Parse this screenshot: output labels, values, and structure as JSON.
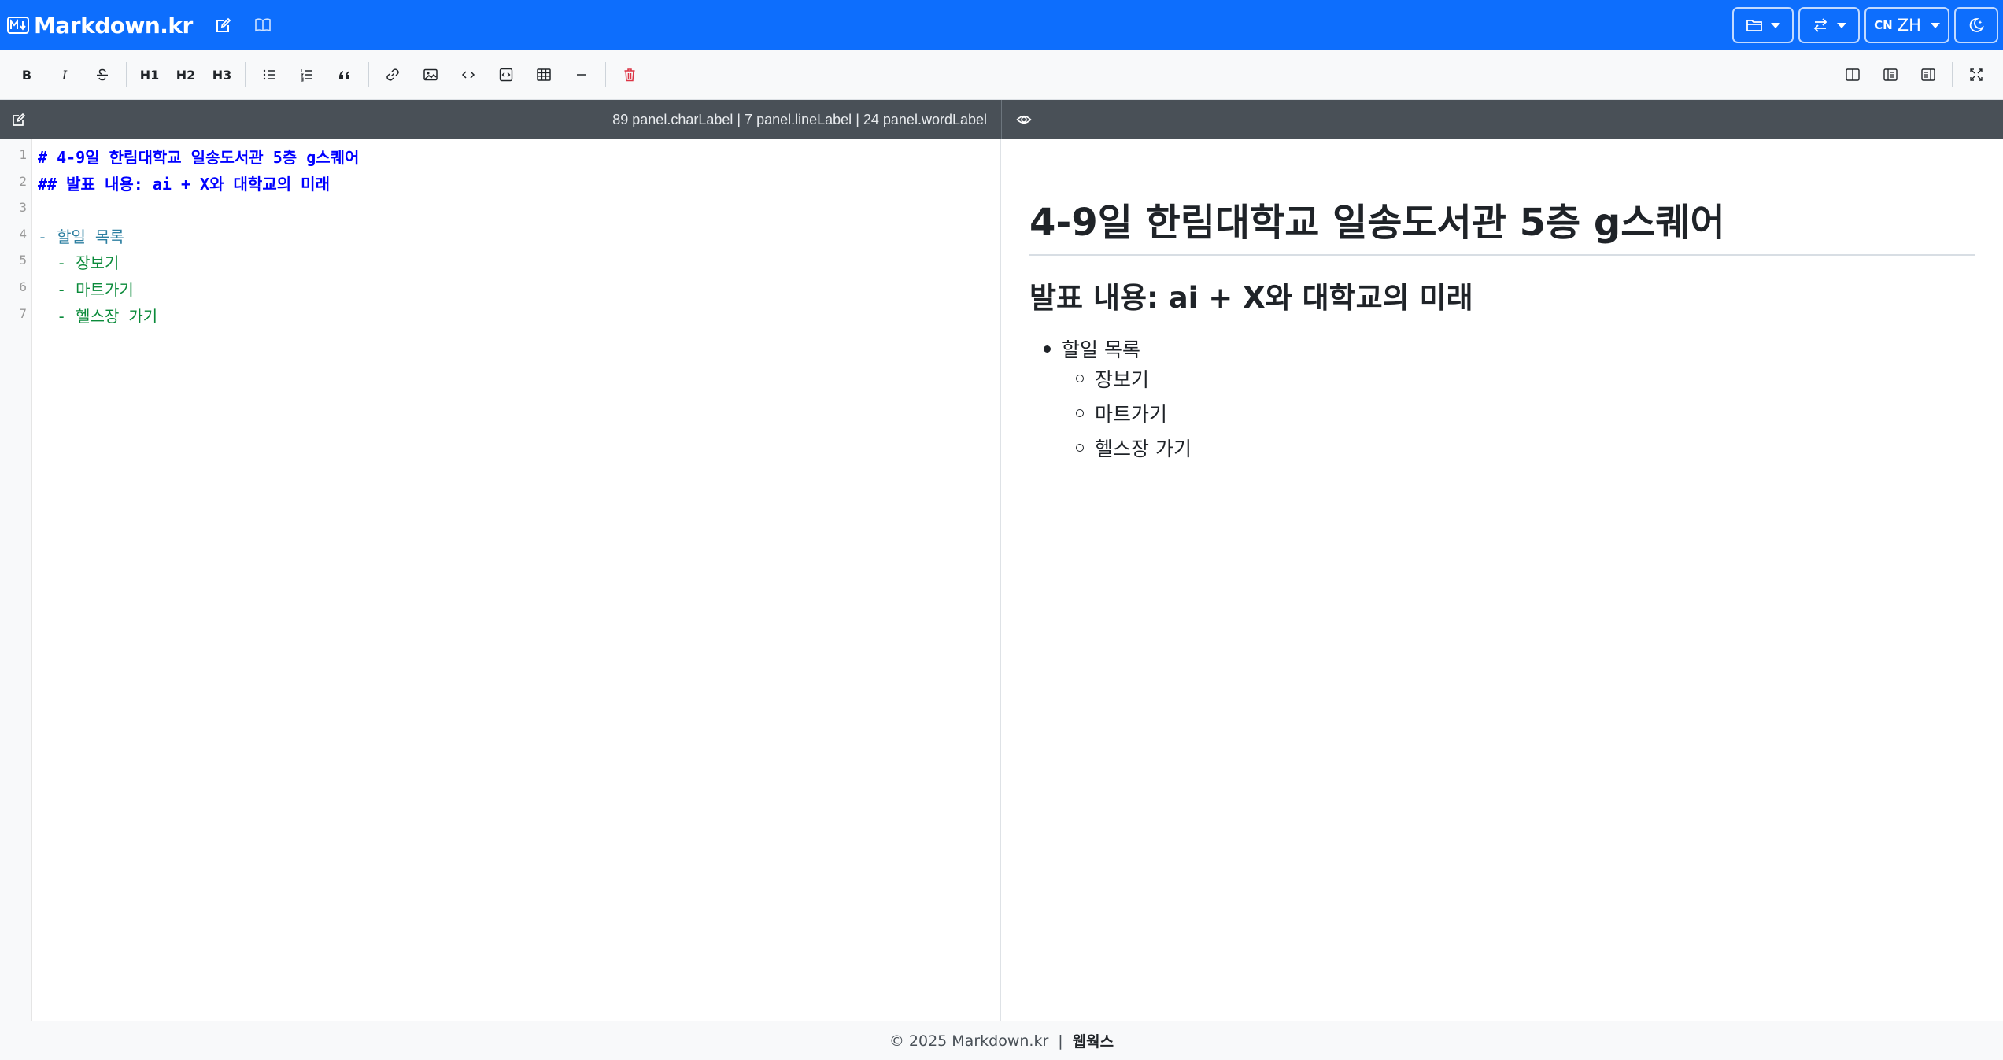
{
  "navbar": {
    "brand_badge": "M↓",
    "brand": "Markdown.kr",
    "lang_flag": "CN",
    "lang_code": "ZH"
  },
  "toolbar": {
    "bold": "B",
    "italic": "I",
    "h1": "H1",
    "h2": "H2",
    "h3": "H3"
  },
  "editor_panel": {
    "char_count": "89 panel.charLabel",
    "line_count": "7 panel.lineLabel",
    "word_count": "24 panel.wordLabel",
    "stats_separator": " | ",
    "line_numbers": [
      "1",
      "2",
      "3",
      "4",
      "5",
      "6",
      "7"
    ],
    "lines": [
      "# 4-9일 한림대학교 일송도서관 5층 g스퀘어",
      "## 발표 내용: ai + X와 대학교의 미래",
      "",
      "- 할일 목록",
      "  - 장보기",
      "  - 마트가기",
      "  - 헬스장 가기"
    ]
  },
  "preview": {
    "h1": "4-9일 한림대학교 일송도서관 5층 g스퀘어",
    "h2": "발표 내용: ai + X와 대학교의 미래",
    "list_item": "할일 목록",
    "sub_items": [
      "장보기",
      "마트가기",
      "헬스장 가기"
    ]
  },
  "footer": {
    "copyright": "© 2025 Markdown.kr",
    "separator": "|",
    "link": "웹웍스"
  },
  "colors": {
    "navbar": "#0d6efd",
    "panel_header": "#495057",
    "heading_syntax": "#0000ff",
    "list_syntax": "#2d7fa1",
    "sublist_syntax": "#0a8a3a",
    "delete_icon": "#dc3545"
  }
}
